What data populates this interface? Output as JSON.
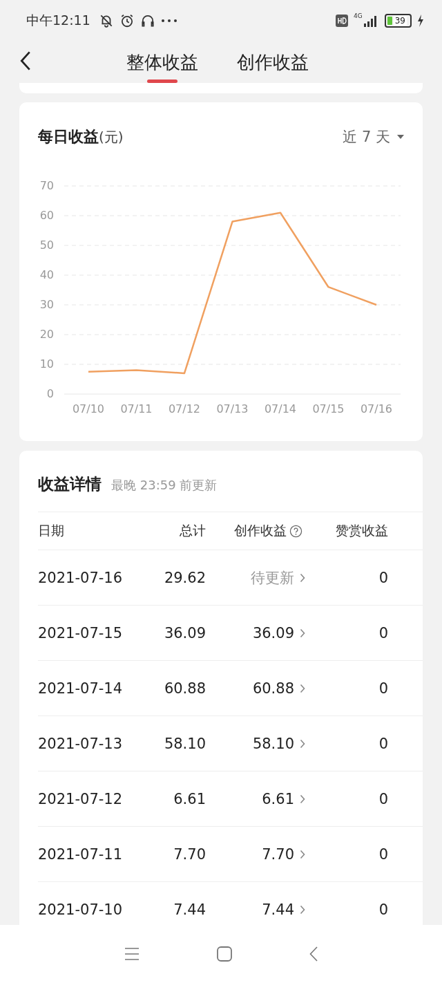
{
  "status_bar": {
    "time": "中午12:11",
    "network": "4G",
    "battery": "39"
  },
  "header": {
    "tabs": [
      {
        "label": "整体收益",
        "selected": true
      },
      {
        "label": "创作收益",
        "selected": false
      }
    ]
  },
  "daily_card": {
    "title": "每日收益",
    "unit": "(元)",
    "range": "近 7 天",
    "chart_data": {
      "type": "line",
      "categories": [
        "07/10",
        "07/11",
        "07/12",
        "07/13",
        "07/14",
        "07/15",
        "07/16"
      ],
      "series": [
        {
          "color": "#f0a060",
          "values": [
            7.5,
            8,
            7,
            58,
            61,
            36,
            30
          ]
        }
      ],
      "grid": true,
      "ylim": [
        0,
        70
      ],
      "yticks": [
        0,
        10,
        20,
        30,
        40,
        50,
        60,
        70
      ]
    }
  },
  "details": {
    "title": "收益详情",
    "note": "最晚 23:59 前更新",
    "columns": [
      "日期",
      "总计",
      "创作收益",
      "赞赏收益"
    ],
    "rows": [
      {
        "date": "2021-07-16",
        "total": "29.62",
        "creation": "待更新",
        "pending": true,
        "reward": "0"
      },
      {
        "date": "2021-07-15",
        "total": "36.09",
        "creation": "36.09",
        "pending": false,
        "reward": "0"
      },
      {
        "date": "2021-07-14",
        "total": "60.88",
        "creation": "60.88",
        "pending": false,
        "reward": "0"
      },
      {
        "date": "2021-07-13",
        "total": "58.10",
        "creation": "58.10",
        "pending": false,
        "reward": "0"
      },
      {
        "date": "2021-07-12",
        "total": "6.61",
        "creation": "6.61",
        "pending": false,
        "reward": "0"
      },
      {
        "date": "2021-07-11",
        "total": "7.70",
        "creation": "7.70",
        "pending": false,
        "reward": "0"
      },
      {
        "date": "2021-07-10",
        "total": "7.44",
        "creation": "7.44",
        "pending": false,
        "reward": "0"
      }
    ]
  }
}
